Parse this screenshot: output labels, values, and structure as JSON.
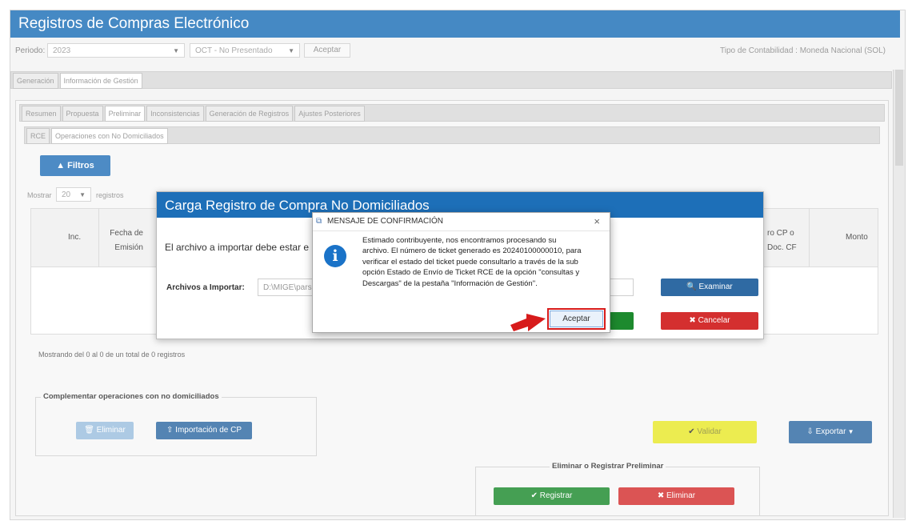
{
  "app": {
    "title": "Registros de Compras Electrónico",
    "tipo_contabilidad": "Tipo de Contabilidad : Moneda Nacional (SOL)"
  },
  "periodo": {
    "label": "Periodo:",
    "year": "2023",
    "month": "OCT - No Presentado",
    "aceptar": "Aceptar"
  },
  "main_tabs": [
    "Generación",
    "Información de Gestión"
  ],
  "sub_tabs": [
    "Resumen",
    "Propuesta",
    "Preliminar",
    "Inconsistencias",
    "Generación de Registros",
    "Ajustes Posteriores"
  ],
  "inner_tabs": [
    "RCE",
    "Operaciones con No Domiciliados"
  ],
  "filtros": "Filtros",
  "mostrar": {
    "label": "Mostrar",
    "value": "20",
    "suffix": "registros"
  },
  "table": {
    "headers": [
      "Inc.",
      "Fecha de Emisión",
      "ro CP o Doc. CF",
      "Monto"
    ]
  },
  "footer_text": "Mostrando del 0 al 0 de un total de 0 registros",
  "complementar": {
    "title": "Complementar operaciones con no domiciliados",
    "eliminar": "Eliminar",
    "importacion": "Importación de CP"
  },
  "validar": "Validar",
  "exportar": "Exportar",
  "preliminar": {
    "title": "Eliminar o Registrar Preliminar",
    "registrar": "Registrar",
    "eliminar": "Eliminar"
  },
  "carga_dialog": {
    "title": "Carga Registro de Compra No Domiciliados",
    "text": "El archivo a importar debe estar e",
    "archivos_label": "Archivos a Importar:",
    "archivo_value": "D:\\MIGE\\pars",
    "examinar": "Examinar",
    "cancelar": "Cancelar"
  },
  "confirm_dialog": {
    "title": "MENSAJE DE CONFIRMACIÓN",
    "message_lines": [
      "Estimado contribuyente, nos encontramos procesando su",
      "archivo. El número de ticket generado es 20240100000010, para",
      "verificar el estado del ticket puede consultarlo a través de la sub",
      "opción Estado de Envío de Ticket RCE de la opción \"consultas y",
      "Descargas\" de la pestaña \"Información de Gestión\"."
    ],
    "aceptar": "Aceptar"
  }
}
